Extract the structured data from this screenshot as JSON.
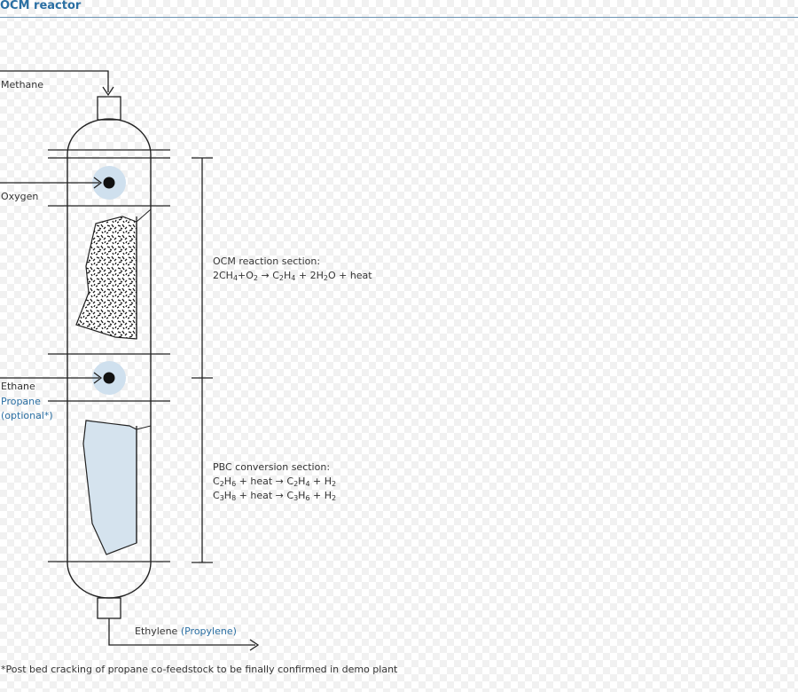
{
  "header": {
    "title": "OCM reactor"
  },
  "inputs": {
    "methane": "Methane",
    "oxygen": "Oxygen",
    "ethane": "Ethane",
    "propane": "Propane",
    "propane_note": "(optional*)"
  },
  "output": {
    "ethylene": "Ethylene",
    "propylene": "(Propylene)"
  },
  "sections": {
    "ocm": {
      "title": "OCM reaction section:",
      "eq": {
        "a": "2CH",
        "a_sub": "4",
        "b": "+O",
        "b_sub": "2",
        "arrow": " → C",
        "c_sub": "2",
        "d": "H",
        "d_sub": "4",
        "rest": " + 2H",
        "e_sub": "2",
        "end": "O + heat"
      }
    },
    "pbc": {
      "title": "PBC conversion section:",
      "eq1": {
        "a": "C",
        "a_sub1": "2",
        "b": "H",
        "b_sub": "6",
        "mid": " + heat → C",
        "c_sub": "2",
        "d": "H",
        "d_sub": "4",
        "rest": " + H",
        "e_sub": "2"
      },
      "eq2": {
        "a": "C",
        "a_sub1": "3",
        "b": "H",
        "b_sub": "8",
        "mid": " + heat → C",
        "c_sub": "3",
        "d": "H",
        "d_sub": "6",
        "rest": " + H",
        "e_sub": "2"
      }
    }
  },
  "footnote": "*Post bed cracking of propane co-feedstock to be finally confirmed in demo plant",
  "colors": {
    "accent": "#2a6fa3",
    "injector_halo": "#cfe0ee",
    "pbc_fill": "#d5e3ee"
  }
}
